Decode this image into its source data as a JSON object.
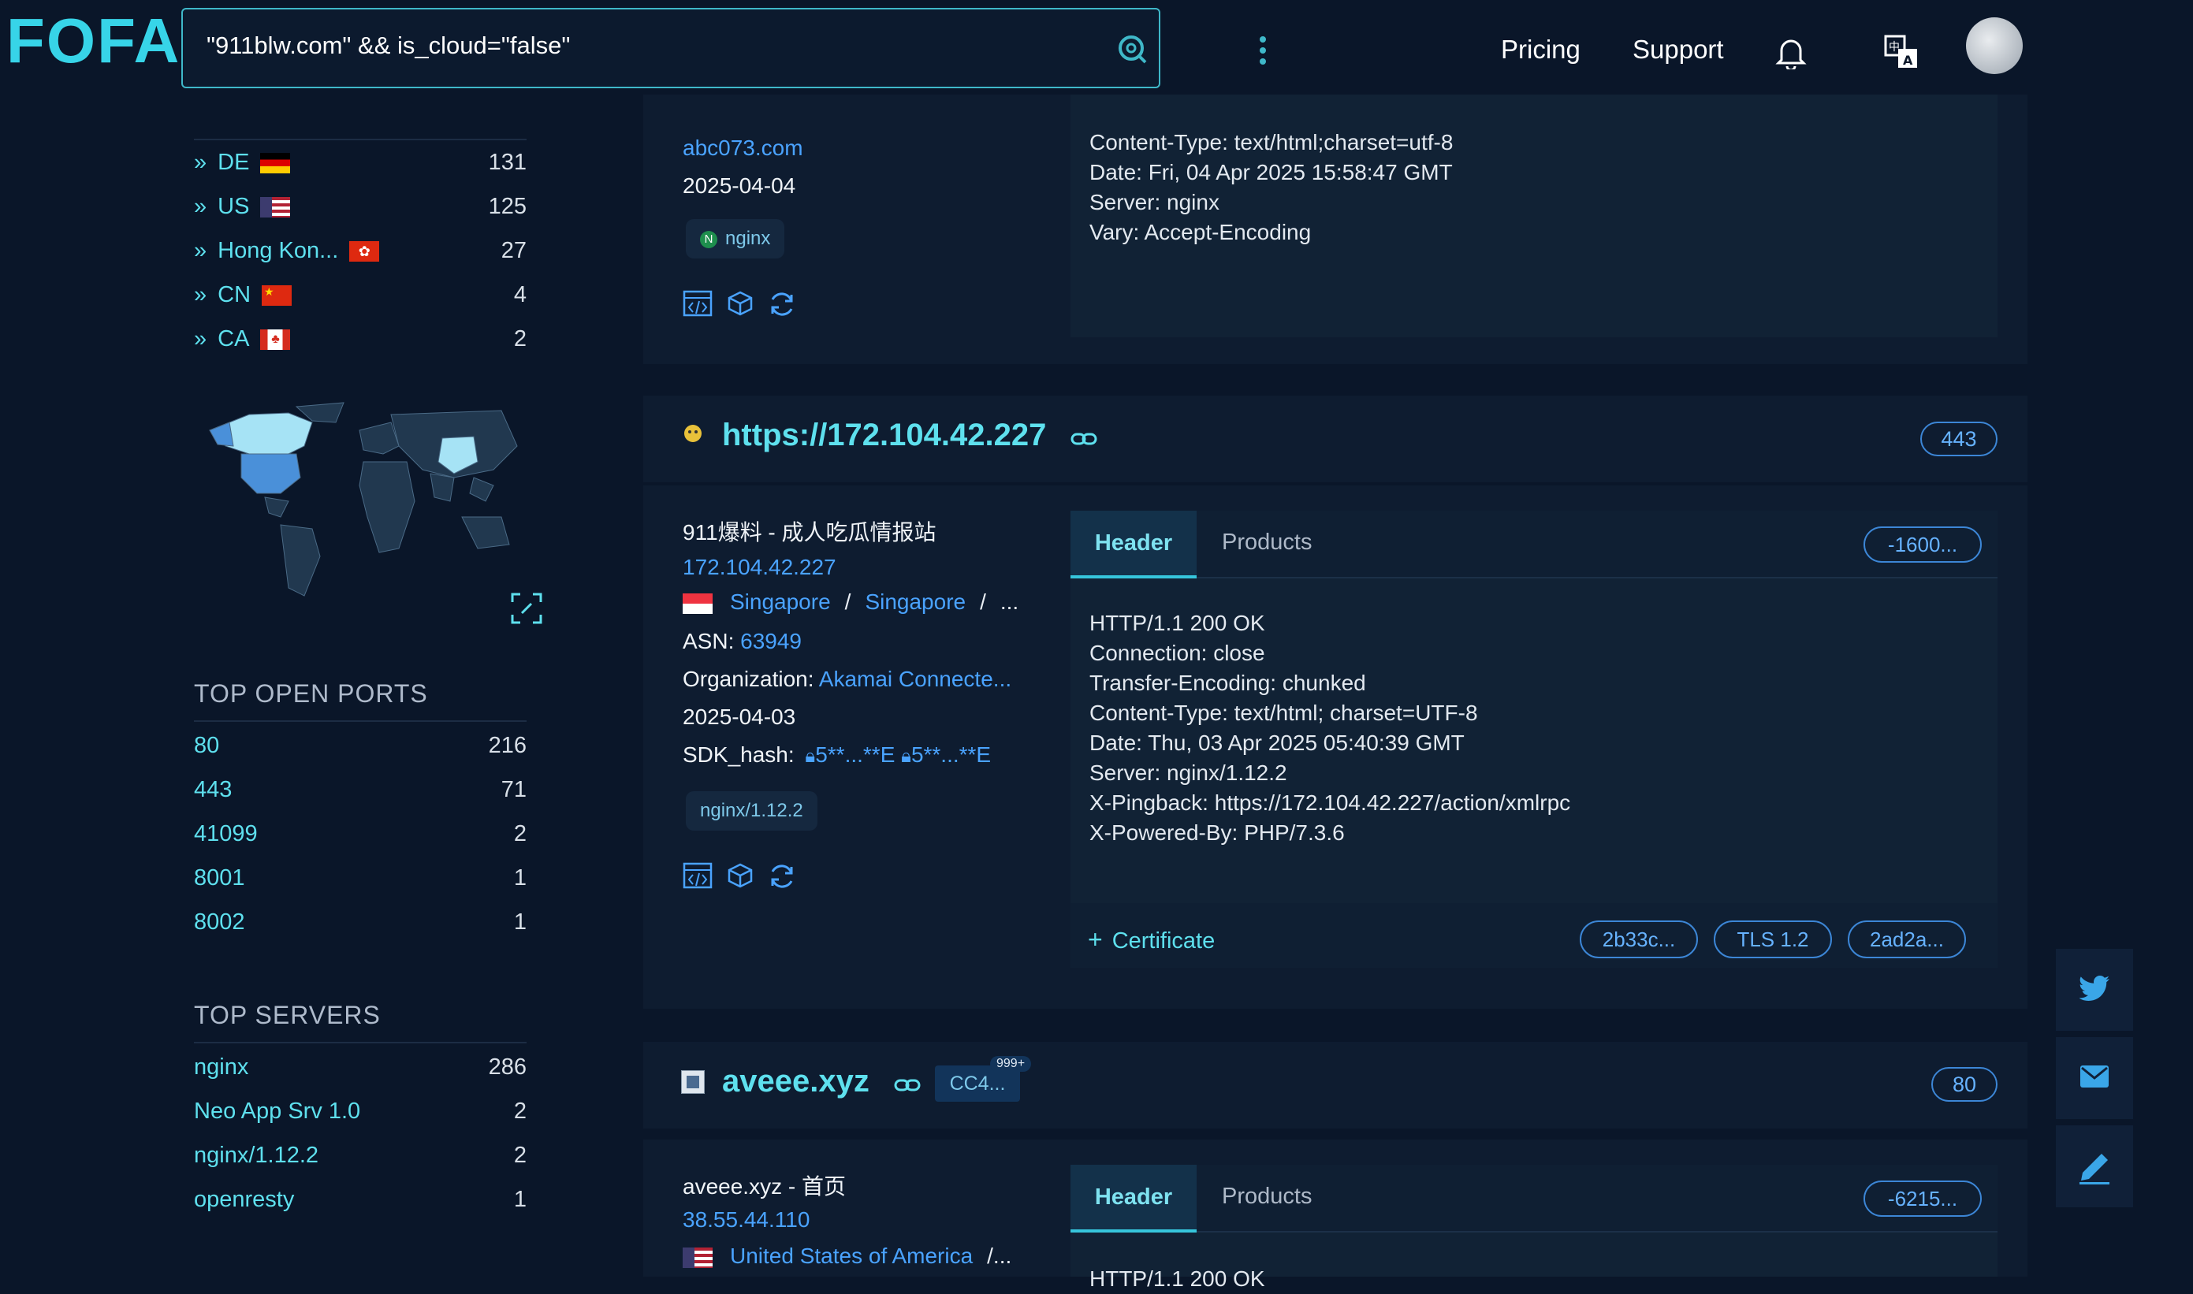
{
  "header": {
    "logo": "FOFA",
    "search_value": "\"911blw.com\" && is_cloud=\"false\"",
    "nav_pricing": "Pricing",
    "nav_support": "Support"
  },
  "sidebar": {
    "countries": [
      {
        "label": "DE",
        "count": "131"
      },
      {
        "label": "US",
        "count": "125"
      },
      {
        "label": "Hong Kon...",
        "count": "27"
      },
      {
        "label": "CN",
        "count": "4"
      },
      {
        "label": "CA",
        "count": "2"
      }
    ],
    "ports_title": "TOP OPEN PORTS",
    "ports": [
      {
        "label": "80",
        "count": "216"
      },
      {
        "label": "443",
        "count": "71"
      },
      {
        "label": "41099",
        "count": "2"
      },
      {
        "label": "8001",
        "count": "1"
      },
      {
        "label": "8002",
        "count": "1"
      }
    ],
    "servers_title": "TOP SERVERS",
    "servers": [
      {
        "label": "nginx",
        "count": "286"
      },
      {
        "label": "Neo App Srv 1.0",
        "count": "2"
      },
      {
        "label": "nginx/1.12.2",
        "count": "2"
      },
      {
        "label": "openresty",
        "count": "1"
      }
    ]
  },
  "card1": {
    "domain": "abc073.com",
    "date": "2025-04-04",
    "tag": "nginx",
    "header_lines": [
      "Content-Type: text/html;charset=utf-8",
      "Date: Fri, 04 Apr 2025 15:58:47 GMT",
      "Server: nginx",
      "Vary: Accept-Encoding"
    ]
  },
  "card2": {
    "url": "https://172.104.42.227",
    "port": "443",
    "title": "911爆料 - 成人吃瓜情报站",
    "ip": "172.104.42.227",
    "country": "Singapore",
    "city": "Singapore",
    "sep": "/",
    "more": "...",
    "asn_label": "ASN:",
    "asn": "63949",
    "org_label": "Organization:",
    "org": "Akamai Connecte...",
    "date": "2025-04-03",
    "sdk_label": "SDK_hash:",
    "sdk1": "5**...**E",
    "sdk2": "5**...**E",
    "tag": "nginx/1.12.2",
    "tab_header": "Header",
    "tab_products": "Products",
    "hash_pill": "-1600...",
    "header_lines": [
      "HTTP/1.1 200 OK",
      "Connection: close",
      "Transfer-Encoding: chunked",
      "Content-Type: text/html; charset=UTF-8",
      "Date: Thu, 03 Apr 2025 05:40:39 GMT",
      "Server: nginx/1.12.2",
      "X-Pingback: https://172.104.42.227/action/xmlrpc",
      "X-Powered-By: PHP/7.3.6"
    ],
    "cert_label": "Certificate",
    "cert_pills": [
      "2b33c...",
      "TLS 1.2",
      "2ad2a..."
    ]
  },
  "card3": {
    "host": "aveee.xyz",
    "badge": "CC4...",
    "badge_count": "999+",
    "port": "80",
    "title": "aveee.xyz - 首页",
    "ip": "38.55.44.110",
    "country": "United States of America",
    "more": "/...",
    "tab_header": "Header",
    "tab_products": "Products",
    "hash_pill": "-6215...",
    "header_first": "HTTP/1.1 200 OK"
  },
  "colors": {
    "background": "#0a1629",
    "card": "#0e1c30",
    "accent_cyan": "#5ee0ee",
    "link_blue": "#4aa3ff"
  }
}
